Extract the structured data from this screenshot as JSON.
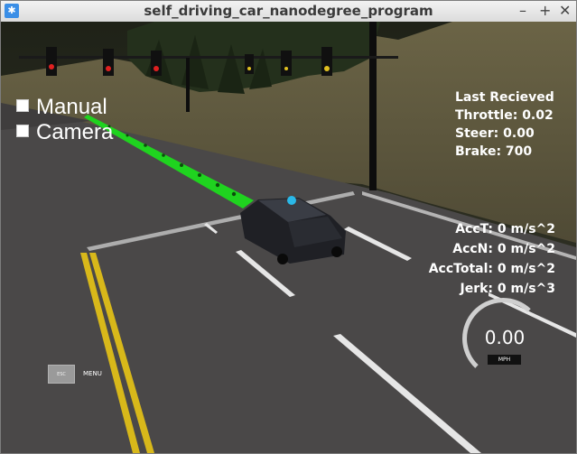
{
  "window": {
    "title": "self_driving_car_nanodegree_program",
    "controls": {
      "minimize": "–",
      "maximize": "+",
      "close": "✕"
    }
  },
  "toggles": {
    "manual": {
      "label": "Manual",
      "checked": false
    },
    "camera": {
      "label": "Camera",
      "checked": false
    }
  },
  "status": {
    "header": "Last Recieved",
    "throttle": "Throttle: 0.02",
    "steer": "Steer: 0.00",
    "brake": "Brake: 700"
  },
  "acceleration": {
    "acc_t": "AccT: 0 m/s^2",
    "acc_n": "AccN: 0 m/s^2",
    "acc_total": "AccTotal: 0 m/s^2",
    "jerk": "Jerk: 0 m/s^3"
  },
  "speedometer": {
    "value": "0.00",
    "unit": "MPH"
  },
  "menu": {
    "esc_label": "ESC",
    "label": "MENU"
  },
  "colors": {
    "path": "#1fd31f",
    "hud_text": "#ffffff",
    "lane_yellow": "#d8b81a",
    "road": "#4a4848"
  }
}
